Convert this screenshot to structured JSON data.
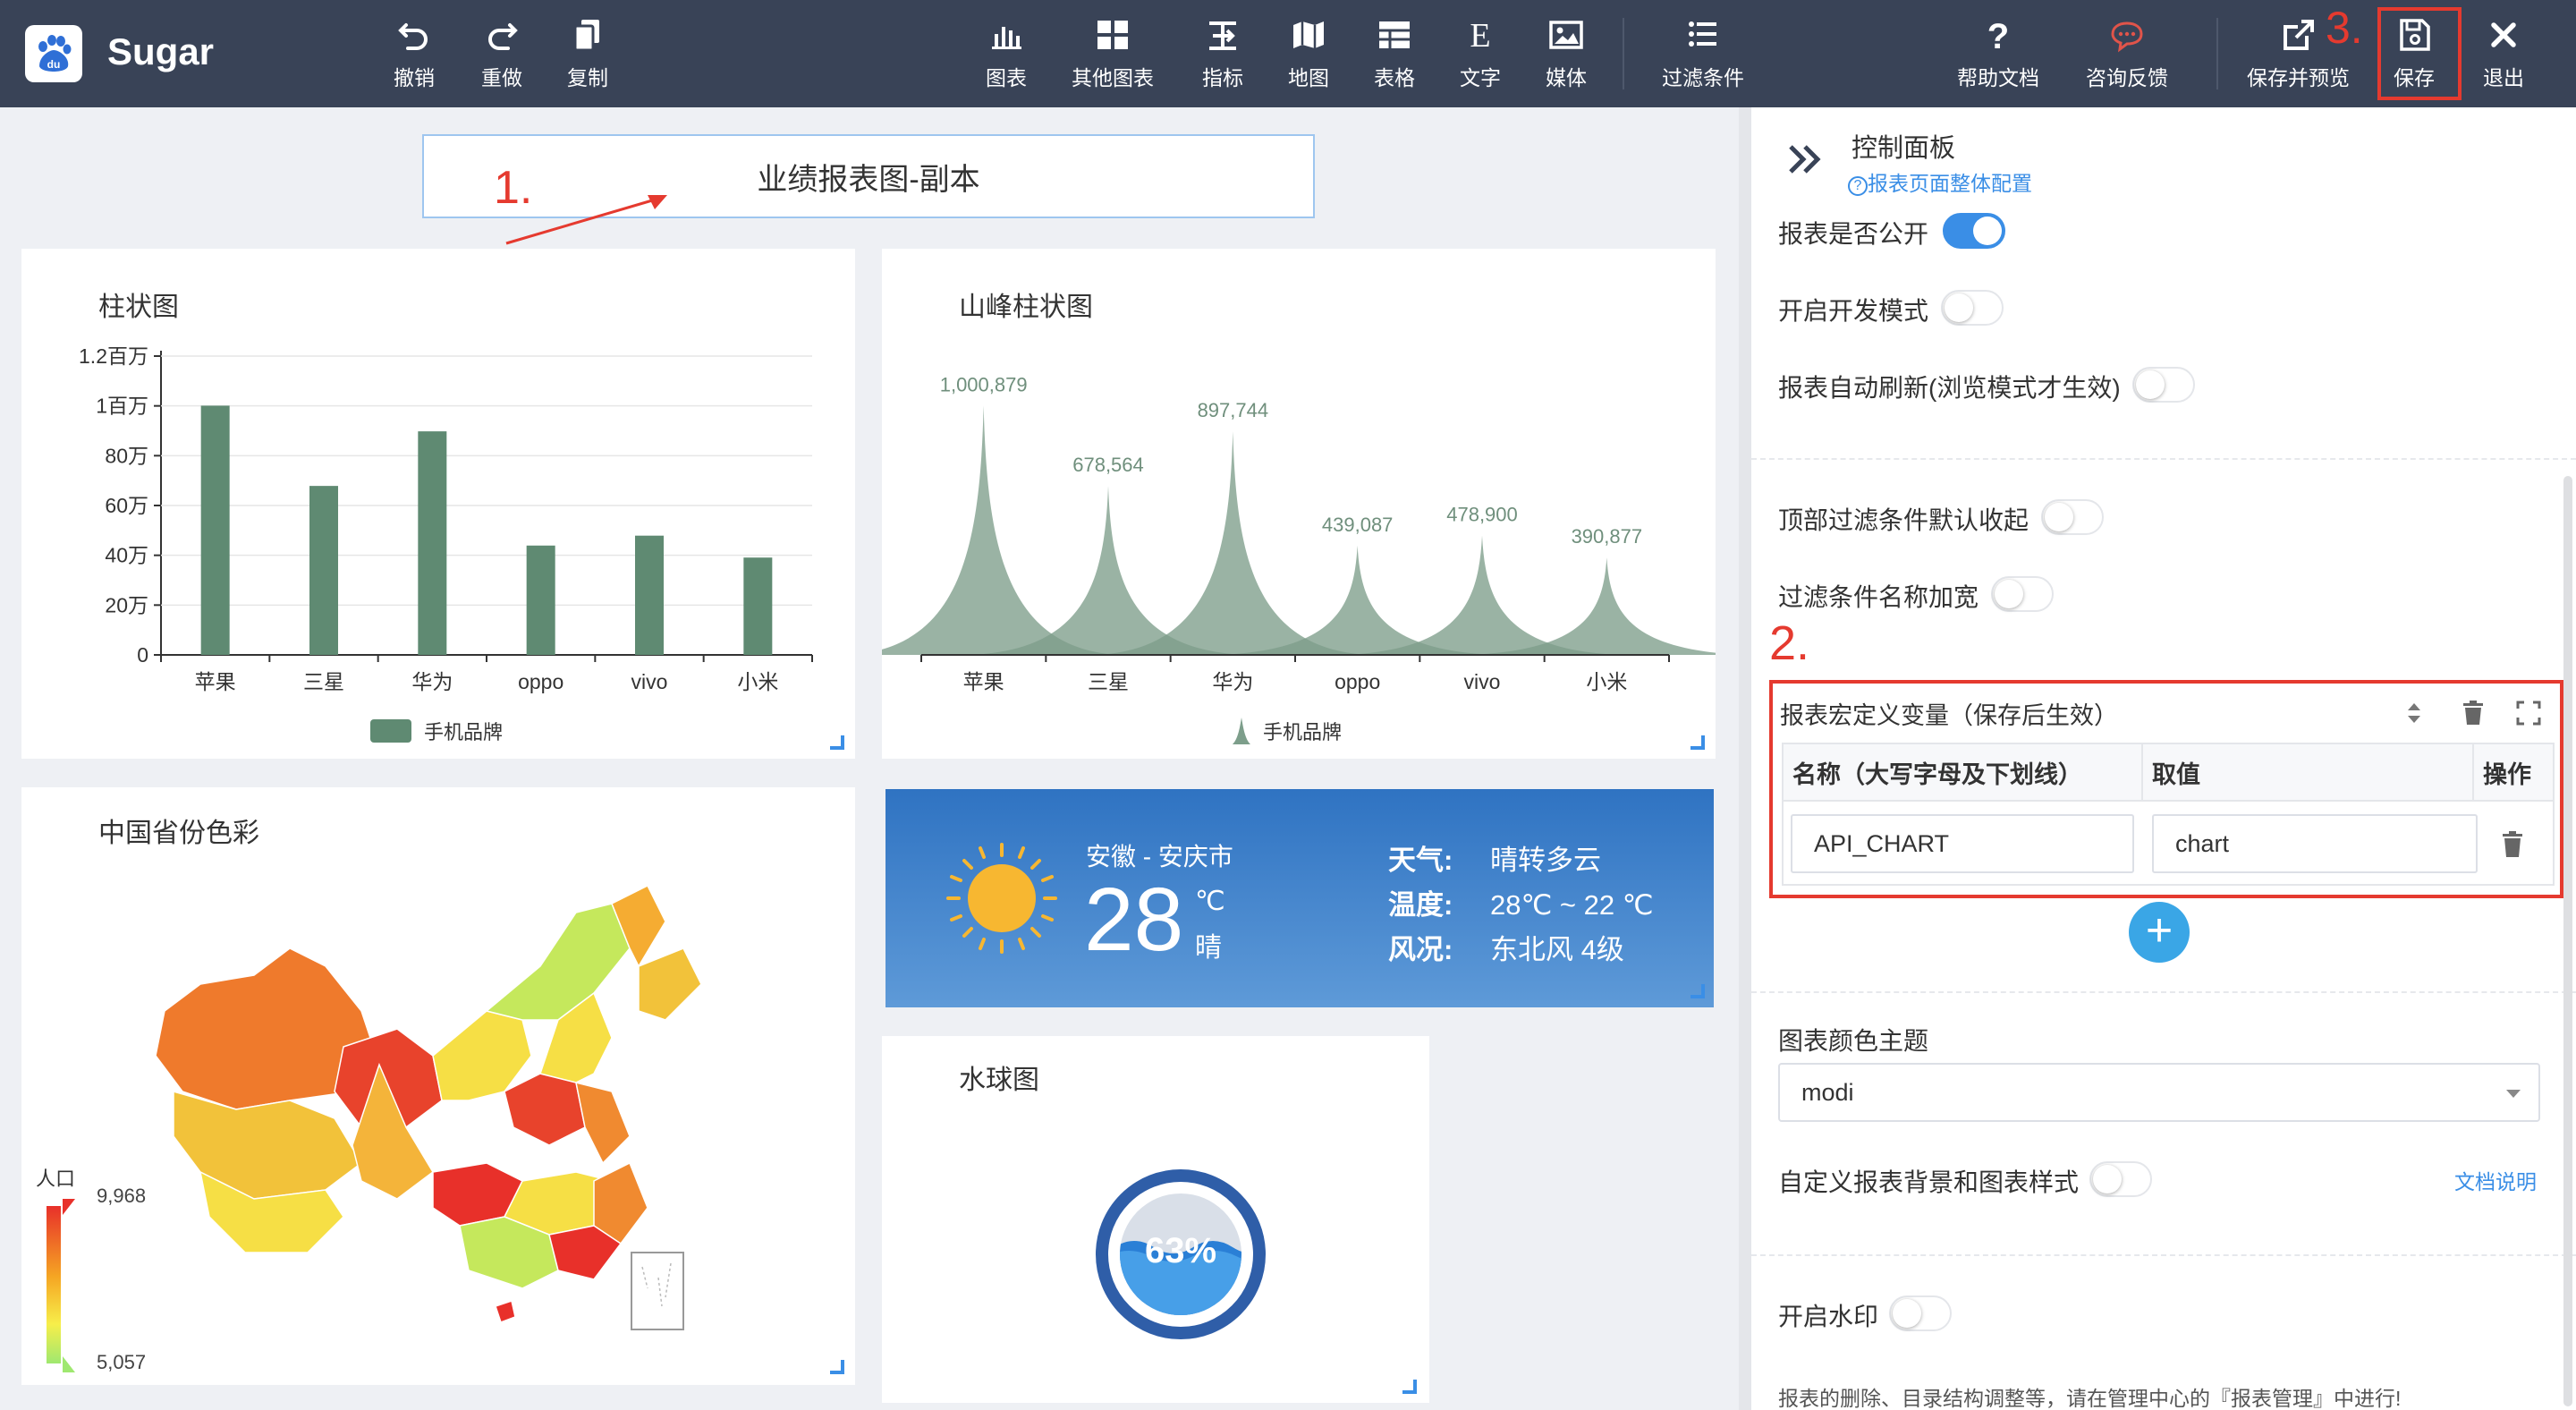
{
  "app": {
    "name": "Sugar"
  },
  "toolbar": {
    "left": [
      {
        "label": "撤销",
        "icon": "undo-icon"
      },
      {
        "label": "重做",
        "icon": "redo-icon"
      },
      {
        "label": "复制",
        "icon": "copy-icon"
      }
    ],
    "center": [
      {
        "label": "图表",
        "icon": "bar-chart-icon"
      },
      {
        "label": "其他图表",
        "icon": "grid-icon"
      },
      {
        "label": "指标",
        "icon": "metric-icon"
      },
      {
        "label": "地图",
        "icon": "map-icon"
      },
      {
        "label": "表格",
        "icon": "table-icon"
      },
      {
        "label": "文字",
        "icon": "text-icon"
      },
      {
        "label": "媒体",
        "icon": "media-icon"
      },
      {
        "label": "过滤条件",
        "icon": "filter-list-icon"
      }
    ],
    "right": [
      {
        "label": "帮助文档",
        "icon": "question-icon"
      },
      {
        "label": "咨询反馈",
        "icon": "chat-icon"
      },
      {
        "label": "保存并预览",
        "icon": "external-link-icon"
      },
      {
        "label": "保存",
        "icon": "floppy-icon"
      },
      {
        "label": "退出",
        "icon": "close-icon"
      }
    ]
  },
  "annotations": {
    "a1": "1.",
    "a2": "2.",
    "a3": "3."
  },
  "report": {
    "title": "业绩报表图-副本"
  },
  "charts": {
    "bar": {
      "title": "柱状图",
      "legend": "手机品牌"
    },
    "peak": {
      "title": "山峰柱状图",
      "legend": "手机品牌"
    },
    "map": {
      "title": "中国省份色彩",
      "legend_title": "人口",
      "legend_max": "9,968",
      "legend_min": "5,057"
    },
    "liquid": {
      "title": "水球图",
      "value_label": "63%"
    }
  },
  "chart_data": [
    {
      "type": "bar",
      "title": "柱状图",
      "categories": [
        "苹果",
        "三星",
        "华为",
        "oppo",
        "vivo",
        "小米"
      ],
      "series": [
        {
          "name": "手机品牌",
          "values": [
            1000879,
            678564,
            897744,
            439087,
            478900,
            390877
          ]
        }
      ],
      "y_ticks": [
        "0",
        "20万",
        "40万",
        "60万",
        "80万",
        "1百万",
        "1.2百万"
      ],
      "ylim": [
        0,
        1200000
      ],
      "legend": "bottom",
      "color": "#5f8a72"
    },
    {
      "type": "area",
      "title": "山峰柱状图",
      "categories": [
        "苹果",
        "三星",
        "华为",
        "oppo",
        "vivo",
        "小米"
      ],
      "series": [
        {
          "name": "手机品牌",
          "values": [
            1000879,
            678564,
            897744,
            439087,
            478900,
            390877
          ]
        }
      ],
      "data_labels": [
        "1,000,879",
        "678,564",
        "897,744",
        "439,087",
        "478,900",
        "390,877"
      ],
      "ylim": [
        0,
        1200000
      ],
      "legend": "bottom",
      "color": "#7d9e8b"
    }
  ],
  "weather": {
    "city": "安徽 - 安庆市",
    "temp": "28",
    "unit": "℃",
    "cond": "晴",
    "rows": [
      {
        "k": "天气:",
        "v": "晴转多云"
      },
      {
        "k": "温度:",
        "v": "28℃ ~ 22 ℃"
      },
      {
        "k": "风况:",
        "v": "东北风 4级"
      }
    ]
  },
  "panel": {
    "title": "控制面板",
    "config_link": "报表页面整体配置",
    "toggles": [
      {
        "label": "报表是否公开",
        "on": true
      },
      {
        "label": "开启开发模式",
        "on": false
      },
      {
        "label": "报表自动刷新(浏览模式才生效)",
        "on": false
      },
      {
        "label": "顶部过滤条件默认收起",
        "on": false
      },
      {
        "label": "过滤条件名称加宽",
        "on": false
      }
    ],
    "macro": {
      "title": "报表宏定义变量（保存后生效）",
      "col_name": "名称（大写字母及下划线）",
      "col_value": "取值",
      "col_op": "操作",
      "rows": [
        {
          "name": "API_CHART",
          "value": "chart"
        }
      ]
    },
    "theme": {
      "label": "图表颜色主题",
      "value": "modi"
    },
    "custom_style": {
      "label": "自定义报表背景和图表样式",
      "link": "文档说明"
    },
    "watermark": {
      "label": "开启水印"
    },
    "footer": "报表的删除、目录结构调整等，请在管理中心的『报表管理』中进行!"
  },
  "colors": {
    "topbar": "#394357",
    "accent": "#3a8ee6",
    "annotation": "#e53a2f"
  }
}
